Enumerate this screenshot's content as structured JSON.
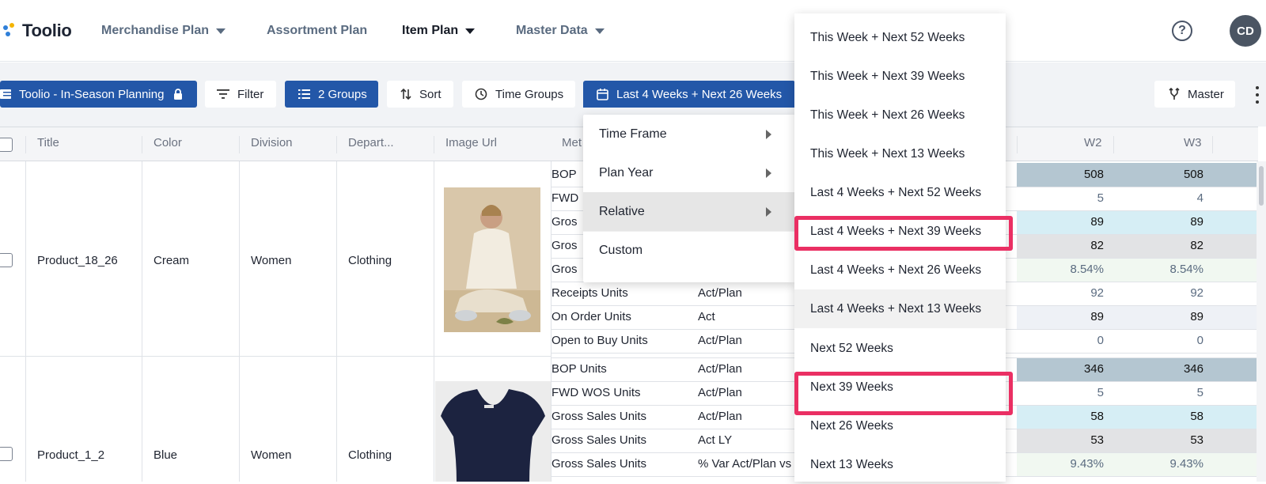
{
  "brand": {
    "name": "Toolio"
  },
  "nav": [
    {
      "label": "Merchandise Plan",
      "caret": true
    },
    {
      "label": "Assortment Plan",
      "caret": false
    },
    {
      "label": "Item Plan",
      "caret": true
    },
    {
      "label": "Master Data",
      "caret": true
    }
  ],
  "header": {
    "help": "?",
    "avatar": "CD"
  },
  "toolbar": {
    "view_name": "Toolio - In-Season Planning",
    "filter": "Filter",
    "groups": "2 Groups",
    "sort": "Sort",
    "time_groups": "Time Groups",
    "time_range": "Last 4 Weeks + Next 26 Weeks",
    "version": "Master"
  },
  "columns": [
    "Title",
    "Color",
    "Division",
    "Depart...",
    "Image Url",
    "Met",
    "W2",
    "W3"
  ],
  "products": [
    {
      "title": "Product_18_26",
      "color": "Cream",
      "division": "Women",
      "department": "Clothing"
    },
    {
      "title": "Product_1_2",
      "color": "Blue",
      "division": "Women",
      "department": "Clothing"
    }
  ],
  "metric_rows": [
    {
      "metric": "BOP",
      "version": "",
      "w2": "508",
      "w3": "508"
    },
    {
      "metric": "FWD",
      "version": "",
      "w2": "5",
      "w3": "4"
    },
    {
      "metric": "Gros",
      "version": "",
      "w2": "89",
      "w3": "89"
    },
    {
      "metric": "Gros",
      "version": "",
      "w2": "82",
      "w3": "82"
    },
    {
      "metric": "Gros",
      "version": "",
      "w2": "8.54%",
      "w3": "8.54%"
    },
    {
      "metric": "Receipts Units",
      "version": "Act/Plan",
      "w2": "92",
      "w3": "92"
    },
    {
      "metric": "On Order Units",
      "version": "Act",
      "w2": "89",
      "w3": "89"
    },
    {
      "metric": "Open to Buy Units",
      "version": "Act/Plan",
      "w2": "0",
      "w3": "0"
    },
    {
      "metric": "BOP Units",
      "version": "Act/Plan",
      "w2": "346",
      "w3": "346"
    },
    {
      "metric": "FWD WOS Units",
      "version": "Act/Plan",
      "w2": "5",
      "w3": "5"
    },
    {
      "metric": "Gross Sales Units",
      "version": "Act/Plan",
      "w2": "58",
      "w3": "58"
    },
    {
      "metric": "Gross Sales Units",
      "version": "Act LY",
      "w2": "53",
      "w3": "53"
    },
    {
      "metric": "Gross Sales Units",
      "version": "% Var Act/Plan vs",
      "w2": "9.43%",
      "w3": "9.43%"
    }
  ],
  "time_menu": {
    "items": [
      {
        "label": "Time Frame",
        "submenu": true
      },
      {
        "label": "Plan Year",
        "submenu": true
      },
      {
        "label": "Relative",
        "submenu": true,
        "active": true
      },
      {
        "label": "Custom",
        "submenu": false
      }
    ]
  },
  "relative_menu": {
    "items": [
      "This Week + Next 52 Weeks",
      "This Week + Next 39 Weeks",
      "This Week + Next 26 Weeks",
      "This Week + Next 13 Weeks",
      "Last 4 Weeks + Next 52 Weeks",
      "Last 4 Weeks + Next 39 Weeks",
      "Last 4 Weeks + Next 26 Weeks",
      "Last 4 Weeks + Next 13 Weeks",
      "Next 52 Weeks",
      "Next 39 Weeks",
      "Next 26 Weeks",
      "Next 13 Weeks"
    ],
    "highlighted": [
      "Last 4 Weeks + Next 39 Weeks",
      "Next 39 Weeks"
    ],
    "hovered": "Last 4 Weeks + Next 13 Weeks"
  },
  "colors": {
    "primary": "#2357a8",
    "highlight": "#ea2f63",
    "bop_row": "#b4c6d1",
    "gross_row": "#d6eef5",
    "grey_row": "#e2e3e5",
    "pct_row": "#f1f8f1",
    "onorder_row": "#eef1f6"
  }
}
